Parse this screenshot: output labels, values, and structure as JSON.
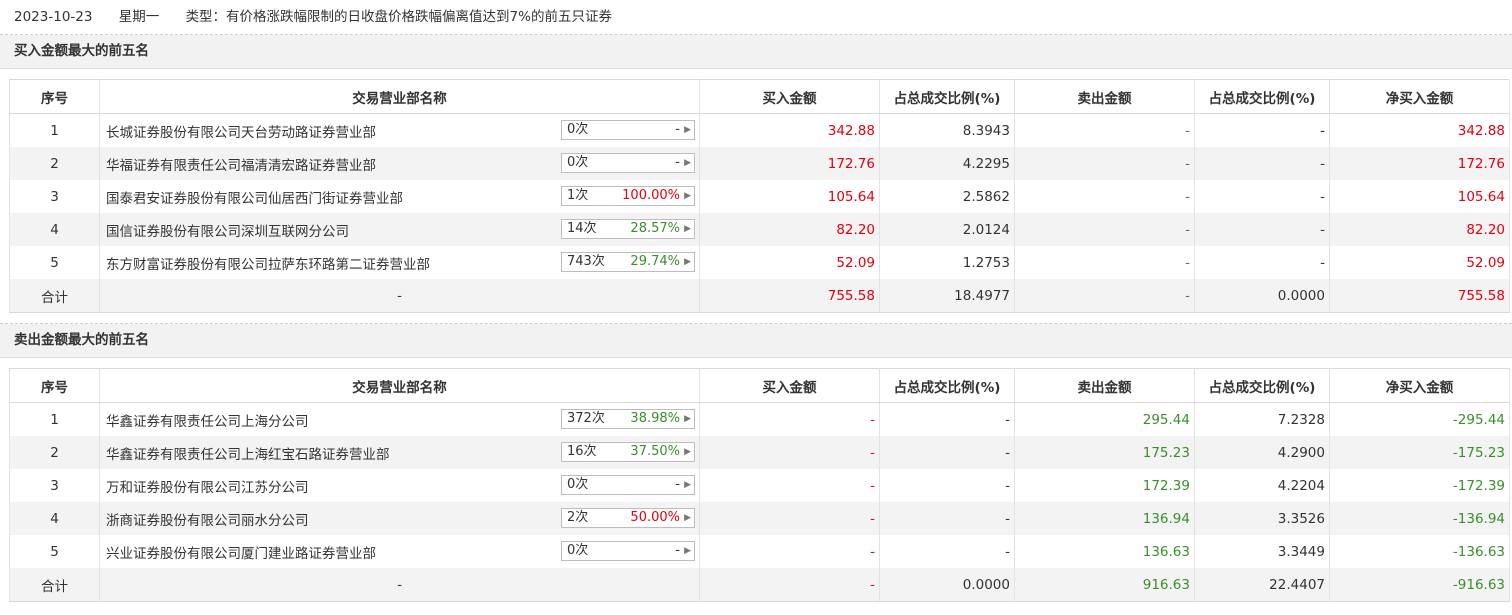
{
  "header": {
    "date": "2023-10-23",
    "weekday": "星期一",
    "type_text": "类型：有价格涨跌幅限制的日收盘价格跌幅偏离值达到7%的前五只证券"
  },
  "columns": {
    "seq": "序号",
    "name": "交易营业部名称",
    "buy": "买入金额",
    "buy_ratio": "占总成交比例(%)",
    "sell": "卖出金额",
    "sell_ratio": "占总成交比例(%)",
    "net": "净买入金额"
  },
  "buy_section": {
    "title": "买入金额最大的前五名",
    "rows": [
      {
        "seq": "1",
        "name": "长城证券股份有限公司天台劳动路证券营业部",
        "count": "0次",
        "pct": "-",
        "buy": "342.88",
        "buy_ratio": "8.3943",
        "sell": "-",
        "sell_ratio": "-",
        "net": "342.88"
      },
      {
        "seq": "2",
        "name": "华福证券有限责任公司福清清宏路证券营业部",
        "count": "0次",
        "pct": "-",
        "buy": "172.76",
        "buy_ratio": "4.2295",
        "sell": "-",
        "sell_ratio": "-",
        "net": "172.76"
      },
      {
        "seq": "3",
        "name": "国泰君安证券股份有限公司仙居西门街证券营业部",
        "count": "1次",
        "pct": "100.00%",
        "buy": "105.64",
        "buy_ratio": "2.5862",
        "sell": "-",
        "sell_ratio": "-",
        "net": "105.64"
      },
      {
        "seq": "4",
        "name": "国信证券股份有限公司深圳互联网分公司",
        "count": "14次",
        "pct": "28.57%",
        "buy": "82.20",
        "buy_ratio": "2.0124",
        "sell": "-",
        "sell_ratio": "-",
        "net": "82.20"
      },
      {
        "seq": "5",
        "name": "东方财富证券股份有限公司拉萨东环路第二证券营业部",
        "count": "743次",
        "pct": "29.74%",
        "buy": "52.09",
        "buy_ratio": "1.2753",
        "sell": "-",
        "sell_ratio": "-",
        "net": "52.09"
      }
    ],
    "total": {
      "label": "合计",
      "name": "-",
      "buy": "755.58",
      "buy_ratio": "18.4977",
      "sell": "-",
      "sell_ratio": "0.0000",
      "net": "755.58"
    }
  },
  "sell_section": {
    "title": "卖出金额最大的前五名",
    "rows": [
      {
        "seq": "1",
        "name": "华鑫证券有限责任公司上海分公司",
        "count": "372次",
        "pct": "38.98%",
        "buy": "-",
        "buy_ratio": "-",
        "sell": "295.44",
        "sell_ratio": "7.2328",
        "net": "-295.44"
      },
      {
        "seq": "2",
        "name": "华鑫证券有限责任公司上海红宝石路证券营业部",
        "count": "16次",
        "pct": "37.50%",
        "buy": "-",
        "buy_ratio": "-",
        "sell": "175.23",
        "sell_ratio": "4.2900",
        "net": "-175.23"
      },
      {
        "seq": "3",
        "name": "万和证券股份有限公司江苏分公司",
        "count": "0次",
        "pct": "-",
        "buy": "-",
        "buy_ratio": "-",
        "sell": "172.39",
        "sell_ratio": "4.2204",
        "net": "-172.39"
      },
      {
        "seq": "4",
        "name": "浙商证券股份有限公司丽水分公司",
        "count": "2次",
        "pct": "50.00%",
        "buy": "-",
        "buy_ratio": "-",
        "sell": "136.94",
        "sell_ratio": "3.3526",
        "net": "-136.94"
      },
      {
        "seq": "5",
        "name": "兴业证券股份有限公司厦门建业路证券营业部",
        "count": "0次",
        "pct": "-",
        "buy": "-",
        "buy_ratio": "-",
        "sell": "136.63",
        "sell_ratio": "3.3449",
        "net": "-136.63"
      }
    ],
    "total": {
      "label": "合计",
      "name": "-",
      "buy": "-",
      "buy_ratio": "0.0000",
      "sell": "916.63",
      "sell_ratio": "22.4407",
      "net": "-916.63"
    }
  },
  "icons": {
    "expand": "triangle-right-icon"
  },
  "colors": {
    "up": "#e4000f",
    "down": "#3a8f2a",
    "pct_up": "#e4000f",
    "pct_down": "#3a8f2a"
  }
}
